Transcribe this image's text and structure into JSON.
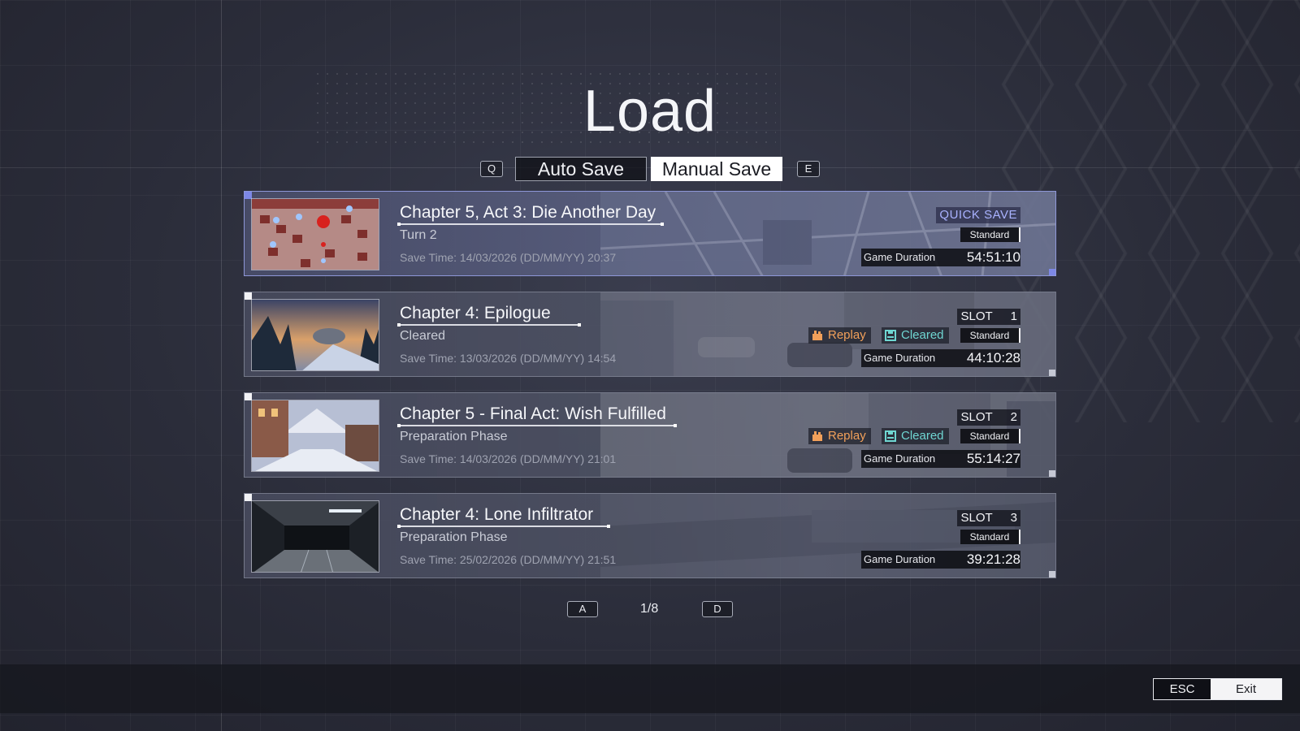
{
  "screen": {
    "title": "Load"
  },
  "tabs": {
    "prev_key": "Q",
    "next_key": "E",
    "items": [
      {
        "label": "Auto Save",
        "active": false
      },
      {
        "label": "Manual Save",
        "active": true
      }
    ]
  },
  "slots": [
    {
      "title": "Chapter 5, Act 3: Die Another Day",
      "subtitle": "Turn 2",
      "save_time": "Save Time: 14/03/2026 (DD/MM/YY) 20:37",
      "slot_label": "QUICK SAVE",
      "mode": "Standard",
      "duration_label": "Game Duration",
      "duration": "54:51:10",
      "selected": true
    },
    {
      "title": "Chapter 4: Epilogue",
      "subtitle": "Cleared",
      "save_time": "Save Time: 13/03/2026 (DD/MM/YY) 14:54",
      "slot_label": "SLOT",
      "slot_number": "1",
      "replay": "Replay",
      "cleared": "Cleared",
      "mode": "Standard",
      "duration_label": "Game Duration",
      "duration": "44:10:28"
    },
    {
      "title": "Chapter 5 - Final Act: Wish Fulfilled",
      "subtitle": "Preparation Phase",
      "save_time": "Save Time: 14/03/2026 (DD/MM/YY) 21:01",
      "slot_label": "SLOT",
      "slot_number": "2",
      "replay": "Replay",
      "cleared": "Cleared",
      "mode": "Standard",
      "duration_label": "Game Duration",
      "duration": "55:14:27"
    },
    {
      "title": "Chapter 4: Lone Infiltrator",
      "subtitle": "Preparation Phase",
      "save_time": "Save Time: 25/02/2026 (DD/MM/YY) 21:51",
      "slot_label": "SLOT",
      "slot_number": "3",
      "mode": "Standard",
      "duration_label": "Game Duration",
      "duration": "39:21:28"
    }
  ],
  "pager": {
    "prev_key": "A",
    "page": "1/8",
    "next_key": "D"
  },
  "footer": {
    "exit_key": "ESC",
    "exit_label": "Exit"
  },
  "colors": {
    "accent_selected": "#8e97d8",
    "quick_save": "#a9b2ff",
    "replay": "#f2a05a",
    "cleared": "#6fd6d2"
  }
}
